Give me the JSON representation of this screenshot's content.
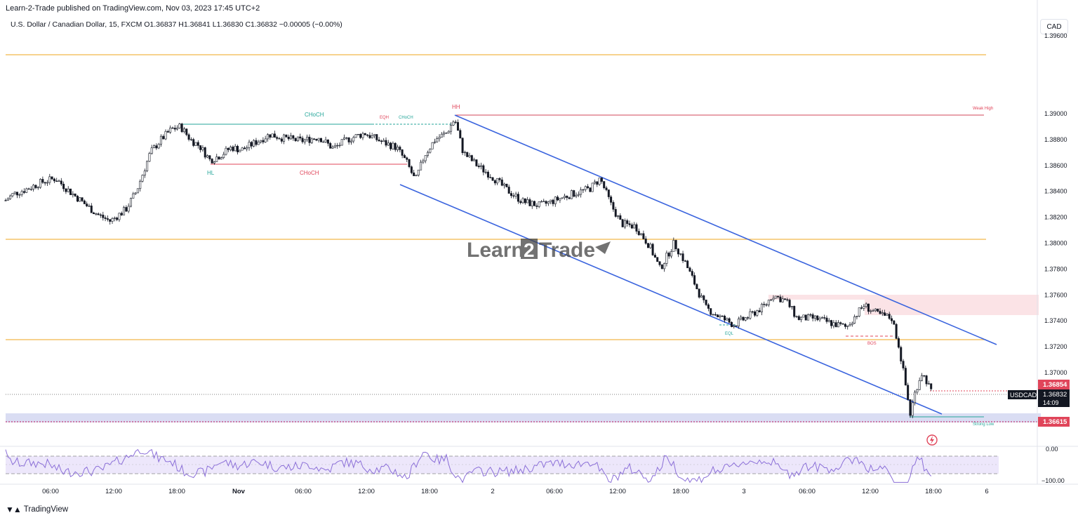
{
  "header": {
    "published": "Learn-2-Trade published on TradingView.com, Nov 03, 2023 17:45 UTC+2",
    "symbol_line": "U.S. Dollar / Canadian Dollar, 15, FXCM  O1.36837  H1.36841  L1.36830  C1.36832  −0.00005 (−0.00%)",
    "currency_button": "CAD"
  },
  "footer": {
    "brand": "TradingView",
    "brand_icon": "tradingview-logo-icon"
  },
  "watermark": {
    "left": "Learn",
    "mid": "2",
    "right": "Trade"
  },
  "colors": {
    "up": "#ffffff",
    "down": "#131722",
    "channel": "#3a64de",
    "level": "#f2b84b",
    "hh_line": "#d2465a",
    "choch_green": "#26a69a",
    "choch_red": "#e0455a",
    "zone_pink": "#fbe3e6",
    "zone_purple": "#d1d4f0",
    "rsi": "#8b6fd8"
  },
  "price_axis": {
    "ticks": [
      "1.39000",
      "1.38800",
      "1.38600",
      "1.38400",
      "1.38200",
      "1.38000",
      "1.37800",
      "1.37600",
      "1.37400",
      "1.37200",
      "1.37000"
    ]
  },
  "price_tags": {
    "red": "1.36854",
    "symbol": "USDCAD",
    "current": "1.36832",
    "countdown": "14:09",
    "low": "1.36615",
    "top_partial": "1.39600"
  },
  "rsi_axis": {
    "top": "0.00",
    "bottom": "−100.00"
  },
  "time_axis": {
    "labels": [
      "06:00",
      "12:00",
      "18:00",
      "Nov",
      "06:00",
      "12:00",
      "18:00",
      "2",
      "06:00",
      "12:00",
      "18:00",
      "3",
      "06:00",
      "12:00",
      "18:00",
      "6"
    ]
  },
  "annotations": {
    "choch_top": "CHoCH",
    "eqh": "EQH",
    "choch_small": "CHoCH",
    "hh": "HH",
    "weak_high": "Weak High",
    "hl": "HL",
    "choch_bottom": "CHoCH",
    "eql": "EQL",
    "bos": "BOS",
    "strong_low": "Strong Low"
  },
  "chart_data": {
    "type": "candlestick",
    "symbol": "USDCAD",
    "interval": "15",
    "ylim": [
      1.3658,
      1.3962
    ],
    "y_ticks": [
      1.39,
      1.388,
      1.386,
      1.384,
      1.382,
      1.38,
      1.378,
      1.376,
      1.374,
      1.372,
      1.37
    ],
    "x_labels": [
      "06:00",
      "12:00",
      "18:00",
      "Nov",
      "06:00",
      "12:00",
      "18:00",
      "2",
      "06:00",
      "12:00",
      "18:00",
      "3",
      "06:00",
      "12:00",
      "18:00",
      "6"
    ],
    "last_close": 1.36832,
    "close_path": [
      [
        0,
        1.3829
      ],
      [
        20,
        1.3838
      ],
      [
        40,
        1.3842
      ],
      [
        60,
        1.3847
      ],
      [
        80,
        1.385
      ],
      [
        100,
        1.384
      ],
      [
        120,
        1.3831
      ],
      [
        140,
        1.3822
      ],
      [
        158,
        1.3817
      ],
      [
        180,
        1.3826
      ],
      [
        195,
        1.384
      ],
      [
        205,
        1.3855
      ],
      [
        215,
        1.387
      ],
      [
        230,
        1.388
      ],
      [
        245,
        1.3888
      ],
      [
        258,
        1.389
      ],
      [
        272,
        1.388
      ],
      [
        285,
        1.3875
      ],
      [
        300,
        1.3864
      ],
      [
        315,
        1.3868
      ],
      [
        330,
        1.3874
      ],
      [
        345,
        1.3872
      ],
      [
        365,
        1.3878
      ],
      [
        385,
        1.3884
      ],
      [
        405,
        1.3881
      ],
      [
        430,
        1.3879
      ],
      [
        455,
        1.3882
      ],
      [
        475,
        1.3873
      ],
      [
        495,
        1.388
      ],
      [
        520,
        1.3885
      ],
      [
        545,
        1.3878
      ],
      [
        565,
        1.3874
      ],
      [
        580,
        1.3862
      ],
      [
        592,
        1.3848
      ],
      [
        605,
        1.3868
      ],
      [
        620,
        1.388
      ],
      [
        636,
        1.3885
      ],
      [
        648,
        1.3896
      ],
      [
        660,
        1.387
      ],
      [
        680,
        1.386
      ],
      [
        700,
        1.3852
      ],
      [
        720,
        1.3842
      ],
      [
        745,
        1.3832
      ],
      [
        770,
        1.3829
      ],
      [
        790,
        1.3833
      ],
      [
        815,
        1.3838
      ],
      [
        840,
        1.3842
      ],
      [
        855,
        1.385
      ],
      [
        870,
        1.383
      ],
      [
        885,
        1.3815
      ],
      [
        905,
        1.3813
      ],
      [
        925,
        1.3798
      ],
      [
        940,
        1.378
      ],
      [
        960,
        1.38
      ],
      [
        975,
        1.3786
      ],
      [
        990,
        1.3768
      ],
      [
        1005,
        1.375
      ],
      [
        1025,
        1.3743
      ],
      [
        1045,
        1.3737
      ],
      [
        1065,
        1.3743
      ],
      [
        1090,
        1.3752
      ],
      [
        1100,
        1.376
      ],
      [
        1120,
        1.3755
      ],
      [
        1135,
        1.3742
      ],
      [
        1160,
        1.3742
      ],
      [
        1185,
        1.3738
      ],
      [
        1205,
        1.3735
      ],
      [
        1215,
        1.3742
      ],
      [
        1230,
        1.3752
      ],
      [
        1250,
        1.3745
      ],
      [
        1270,
        1.3742
      ],
      [
        1280,
        1.372
      ],
      [
        1288,
        1.3695
      ],
      [
        1296,
        1.3668
      ],
      [
        1303,
        1.3685
      ],
      [
        1312,
        1.37
      ],
      [
        1320,
        1.3693
      ],
      [
        1327,
        1.3683
      ]
    ],
    "levels": [
      1.3945,
      1.3803,
      1.3727
    ],
    "channel": {
      "upper": [
        [
          1.39
        ],
        [
          1.3722
        ]
      ],
      "lower": [
        [
          1.3845
        ],
        [
          1.3668
        ]
      ]
    },
    "hh_level": 1.3898,
    "low_level": 1.36615,
    "rsi_range": [
      -100,
      0
    ]
  }
}
